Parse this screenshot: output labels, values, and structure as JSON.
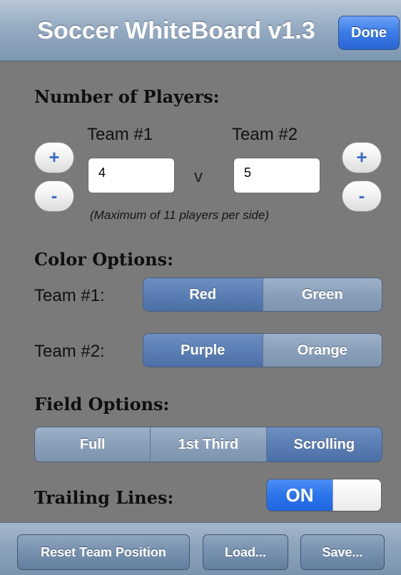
{
  "navbar": {
    "title": "Soccer WhiteBoard v1.3",
    "done_label": "Done"
  },
  "players": {
    "heading": "Number of Players:",
    "team1_label": "Team #1",
    "team2_label": "Team #2",
    "plus_label": "+",
    "minus_label": "-",
    "team1_value": "4",
    "team2_value": "5",
    "vs_label": "v",
    "hint": "(Maximum of 11 players per side)"
  },
  "colors": {
    "heading": "Color Options:",
    "team1_label": "Team #1:",
    "team1_options": [
      "Red",
      "Green"
    ],
    "team1_selected": "Red",
    "team2_label": "Team #2:",
    "team2_options": [
      "Purple",
      "Orange"
    ],
    "team2_selected": "Purple"
  },
  "field": {
    "heading": "Field Options:",
    "options": [
      "Full",
      "1st Third",
      "Scrolling"
    ],
    "selected": "Scrolling"
  },
  "trailing": {
    "heading": "Trailing Lines:",
    "toggle_label": "ON",
    "on": true
  },
  "toolbar": {
    "reset_label": "Reset Team Position",
    "load_label": "Load...",
    "save_label": "Save..."
  },
  "theme": {
    "accent": "#2b74ec",
    "background": "#7a7a7a",
    "bar": "#8ba2bb"
  }
}
